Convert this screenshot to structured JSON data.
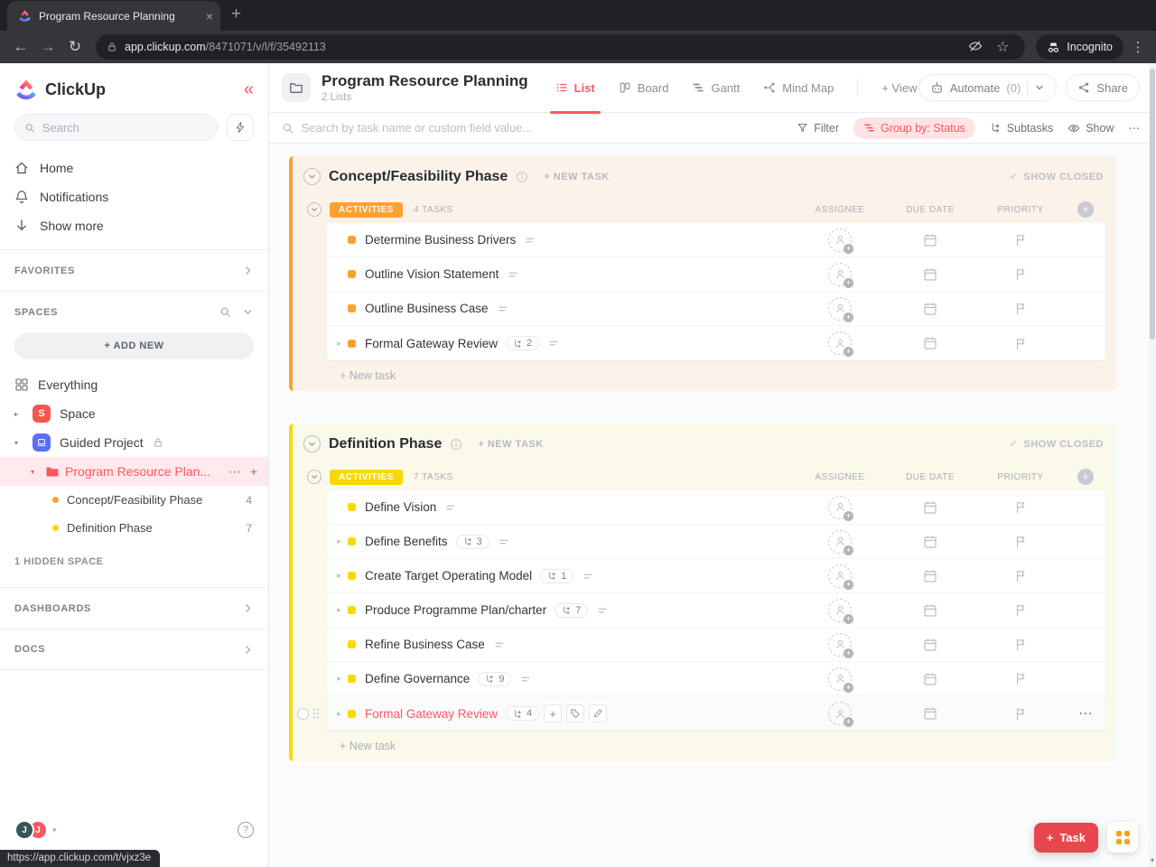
{
  "browser": {
    "tab_title": "Program Resource Planning",
    "url_domain": "app.clickup.com",
    "url_path": "/8471071/v/l/f/35492113",
    "incognito_label": "Incognito"
  },
  "sidebar": {
    "logo_text": "ClickUp",
    "search_placeholder": "Search",
    "nav_home": "Home",
    "nav_notifications": "Notifications",
    "nav_show_more": "Show more",
    "favorites_label": "FAVORITES",
    "spaces_label": "SPACES",
    "add_new_label": "+ ADD NEW",
    "everything_label": "Everything",
    "space_label": "Space",
    "space_avatar": "S",
    "guided_project_label": "Guided Project",
    "project_label": "Program Resource Plan...",
    "lists": [
      {
        "label": "Concept/Feasibility Phase",
        "count": "4"
      },
      {
        "label": "Definition Phase",
        "count": "7"
      }
    ],
    "hidden_space_label": "1 HIDDEN SPACE",
    "dashboards_label": "DASHBOARDS",
    "docs_label": "DOCS",
    "avatars": [
      "J",
      "J"
    ],
    "status_url": "https://app.clickup.com/t/vjxz3e"
  },
  "header": {
    "title": "Program Resource Planning",
    "subtitle": "2 Lists",
    "tabs": [
      {
        "label": "List"
      },
      {
        "label": "Board"
      },
      {
        "label": "Gantt"
      },
      {
        "label": "Mind Map"
      }
    ],
    "view_label": "+ View",
    "automate_label": "Automate",
    "automate_count": "(0)",
    "share_label": "Share"
  },
  "toolbar": {
    "search_placeholder": "Search by task name or custom field value...",
    "filter_label": "Filter",
    "group_by_label": "Group by: Status",
    "subtasks_label": "Subtasks",
    "show_label": "Show"
  },
  "groups": [
    {
      "title": "Concept/Feasibility Phase",
      "new_task_label": "+ NEW TASK",
      "show_closed_label": "SHOW CLOSED",
      "status": "ACTIVITIES",
      "count_label": "4 TASKS",
      "columns": [
        "ASSIGNEE",
        "DUE DATE",
        "PRIORITY"
      ],
      "accent": "#ffa12f",
      "add_task_label": "+ New task",
      "tasks": [
        {
          "name": "Determine Business Drivers"
        },
        {
          "name": "Outline Vision Statement"
        },
        {
          "name": "Outline Business Case"
        },
        {
          "name": "Formal Gateway Review",
          "subtask_count": "2"
        }
      ]
    },
    {
      "title": "Definition Phase",
      "new_task_label": "+ NEW TASK",
      "show_closed_label": "SHOW CLOSED",
      "status": "ACTIVITIES",
      "count_label": "7 TASKS",
      "columns": [
        "ASSIGNEE",
        "DUE DATE",
        "PRIORITY"
      ],
      "accent": "#f9d900",
      "add_task_label": "+ New task",
      "tasks": [
        {
          "name": "Define Vision"
        },
        {
          "name": "Define Benefits",
          "subtask_count": "3"
        },
        {
          "name": "Create Target Operating Model",
          "subtask_count": "1"
        },
        {
          "name": "Produce Programme Plan/charter",
          "subtask_count": "7"
        },
        {
          "name": "Refine Business Case"
        },
        {
          "name": "Define Governance",
          "subtask_count": "9"
        },
        {
          "name": "Formal Gateway Review",
          "subtask_count": "4"
        }
      ]
    }
  ],
  "floating": {
    "task_button_label": "Task"
  },
  "colors": {
    "accent_red": "#fd5661",
    "status_orange": "#ffa12f",
    "status_yellow": "#f9d900"
  }
}
